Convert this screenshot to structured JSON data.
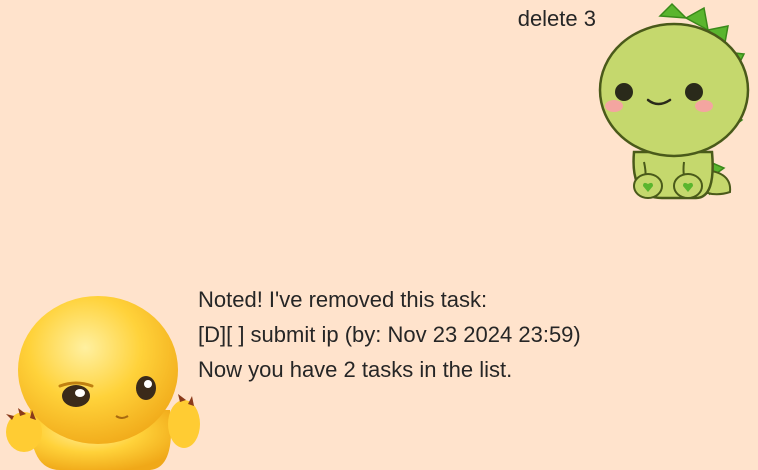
{
  "user_message": {
    "text": "delete 3",
    "avatar_icon": "green-dinosaur-avatar-icon"
  },
  "bot_message": {
    "lines": [
      "Noted! I've removed this task:",
      "[D][ ] submit ip (by: Nov 23 2024 23:59)",
      "Now you have 2 tasks in the list."
    ],
    "avatar_icon": "yellow-creature-avatar-icon"
  },
  "colors": {
    "background": "#ffe3cc",
    "text": "#262626",
    "dino_body": "#c5d86d",
    "dino_spikes": "#5ab52e",
    "creature_body": "#ffcc33"
  }
}
